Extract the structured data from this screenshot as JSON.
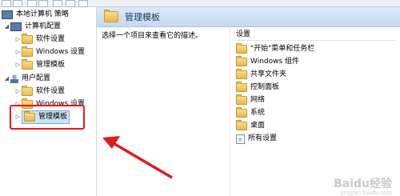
{
  "tree": {
    "root": "本地计算机 策略",
    "computer_config": "计算机配置",
    "software_settings_1": "软件设置",
    "windows_settings_1": "Windows 设置",
    "admin_templates_1": "管理模板",
    "user_config": "用户配置",
    "software_settings_2": "软件设置",
    "windows_settings_2": "Windows 设置",
    "admin_templates_2": "管理模板"
  },
  "right": {
    "title": "管理模板",
    "description": "选择一个项目来查看它的描述。",
    "column_header": "设置",
    "items": [
      "\"开始\"菜单和任务栏",
      "Windows 组件",
      "共享文件夹",
      "控制面板",
      "网络",
      "系统",
      "桌面",
      "所有设置"
    ]
  },
  "watermark": "Bai&#2381;经验",
  "watermark_sub": "jingyan.baidu.com",
  "colors": {
    "annotation": "#e21a1a",
    "selection": "#cce4f7"
  }
}
